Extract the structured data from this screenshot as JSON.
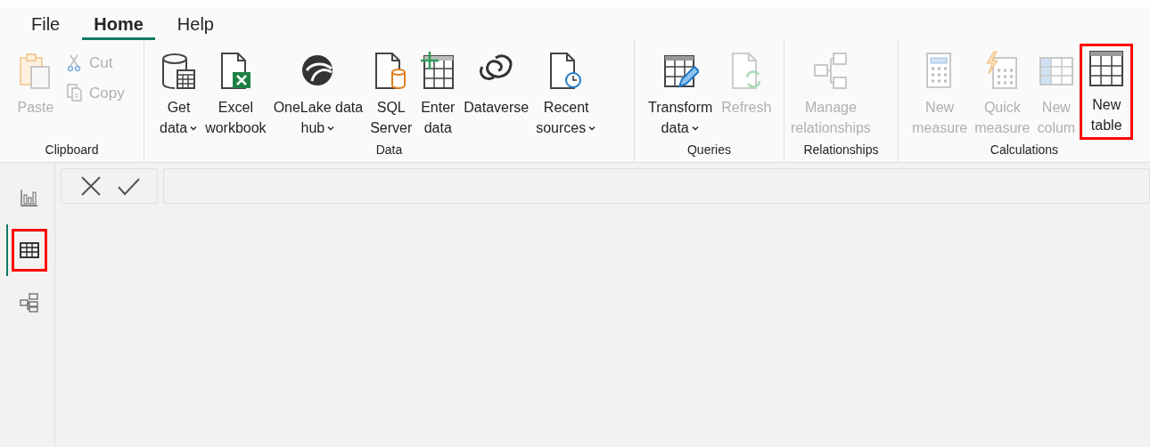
{
  "tabs": [
    {
      "label": "File",
      "selected": false
    },
    {
      "label": "Home",
      "selected": true
    },
    {
      "label": "Help",
      "selected": false
    }
  ],
  "ribbon_groups": [
    {
      "label": "Clipboard",
      "buttons": [
        {
          "kind": "paste",
          "lines": [
            "Paste"
          ],
          "small": false,
          "disabled": true,
          "dropdown": false,
          "highlighted": false
        },
        {
          "kind": "cut",
          "lines": [
            "Cut"
          ],
          "small": true,
          "disabled": true,
          "dropdown": false,
          "highlighted": false
        },
        {
          "kind": "copy",
          "lines": [
            "Copy"
          ],
          "small": true,
          "disabled": true,
          "dropdown": false,
          "highlighted": false
        }
      ]
    },
    {
      "label": "Data",
      "buttons": [
        {
          "kind": "getdata",
          "lines": [
            "Get",
            "data"
          ],
          "small": false,
          "disabled": false,
          "dropdown": true,
          "highlighted": false
        },
        {
          "kind": "excel",
          "lines": [
            "Excel",
            "workbook"
          ],
          "small": false,
          "disabled": false,
          "dropdown": false,
          "highlighted": false
        },
        {
          "kind": "onelake",
          "lines": [
            "OneLake data",
            "hub"
          ],
          "small": false,
          "disabled": false,
          "dropdown": true,
          "highlighted": false
        },
        {
          "kind": "sql",
          "lines": [
            "SQL",
            "Server"
          ],
          "small": false,
          "disabled": false,
          "dropdown": false,
          "highlighted": false
        },
        {
          "kind": "enter",
          "lines": [
            "Enter",
            "data"
          ],
          "small": false,
          "disabled": false,
          "dropdown": false,
          "highlighted": false
        },
        {
          "kind": "dataverse",
          "lines": [
            "Dataverse"
          ],
          "small": false,
          "disabled": false,
          "dropdown": false,
          "highlighted": false
        },
        {
          "kind": "recent",
          "lines": [
            "Recent",
            "sources"
          ],
          "small": false,
          "disabled": false,
          "dropdown": true,
          "highlighted": false
        }
      ]
    },
    {
      "label": "Queries",
      "buttons": [
        {
          "kind": "transform",
          "lines": [
            "Transform",
            "data"
          ],
          "small": false,
          "disabled": false,
          "dropdown": true,
          "highlighted": false
        },
        {
          "kind": "refresh",
          "lines": [
            "Refresh"
          ],
          "small": false,
          "disabled": true,
          "dropdown": false,
          "highlighted": false
        }
      ]
    },
    {
      "label": "Relationships",
      "buttons": [
        {
          "kind": "manage",
          "lines": [
            "Manage",
            "relationships"
          ],
          "small": false,
          "disabled": true,
          "dropdown": false,
          "highlighted": false
        }
      ]
    },
    {
      "label": "Calculations",
      "buttons": [
        {
          "kind": "measure",
          "lines": [
            "New",
            "measure"
          ],
          "small": false,
          "disabled": true,
          "dropdown": false,
          "highlighted": false
        },
        {
          "kind": "quick",
          "lines": [
            "Quick",
            "measure"
          ],
          "small": false,
          "disabled": true,
          "dropdown": false,
          "highlighted": false
        },
        {
          "kind": "column",
          "lines": [
            "New",
            "colum"
          ],
          "small": false,
          "disabled": true,
          "dropdown": false,
          "highlighted": false
        },
        {
          "kind": "table",
          "lines": [
            "New",
            "table"
          ],
          "small": false,
          "disabled": false,
          "dropdown": false,
          "highlighted": true
        }
      ]
    }
  ],
  "views": [
    {
      "kind": "report",
      "selected": false,
      "highlighted": false
    },
    {
      "kind": "table",
      "selected": true,
      "highlighted": true
    },
    {
      "kind": "model",
      "selected": false,
      "highlighted": false
    }
  ],
  "formula_bar": {
    "buttons": [
      {
        "kind": "cancel"
      },
      {
        "kind": "commit"
      }
    ]
  }
}
